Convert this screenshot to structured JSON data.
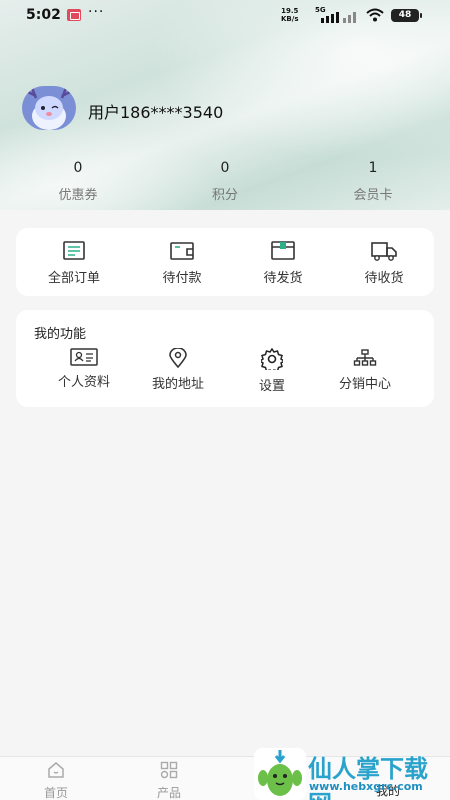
{
  "status_bar": {
    "time": "5:02",
    "more": "···",
    "net_speed_value": "19.5",
    "net_speed_unit": "KB/s",
    "network": "5G",
    "battery": "48"
  },
  "profile": {
    "username": "用户186****3540"
  },
  "stats": [
    {
      "value": "0",
      "label": "优惠券"
    },
    {
      "value": "0",
      "label": "积分"
    },
    {
      "value": "1",
      "label": "会员卡"
    }
  ],
  "orders": [
    {
      "label": "全部订单",
      "icon": "order-list-icon"
    },
    {
      "label": "待付款",
      "icon": "wallet-icon"
    },
    {
      "label": "待发货",
      "icon": "package-icon"
    },
    {
      "label": "待收货",
      "icon": "truck-icon"
    }
  ],
  "functions": {
    "title": "我的功能",
    "items": [
      {
        "label": "个人资料",
        "icon": "id-card-icon"
      },
      {
        "label": "我的地址",
        "icon": "location-pin-icon"
      },
      {
        "label": "设置",
        "icon": "gear-icon"
      },
      {
        "label": "分销中心",
        "icon": "org-chart-icon"
      }
    ]
  },
  "tab_bar": [
    {
      "label": "首页",
      "icon": "home-icon"
    },
    {
      "label": "产品",
      "icon": "grid-icon"
    },
    {
      "label": "我的",
      "icon": "user-icon"
    }
  ],
  "watermark": {
    "text": "仙人掌下载网",
    "url": "www.hebxgrc.com"
  },
  "colors": {
    "accent": "#2aa3cc",
    "hero_bg": "#cfe2db",
    "page_bg": "#f5f5f5"
  }
}
